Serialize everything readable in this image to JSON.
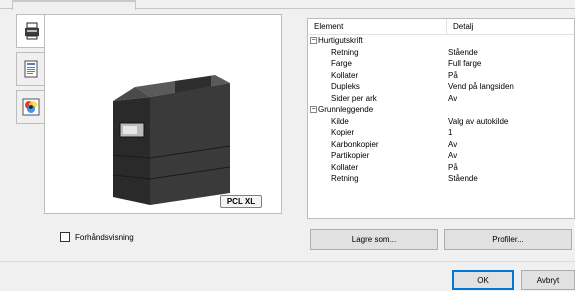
{
  "sidebar": {
    "tabs": [
      {
        "icon": "printer-settings-icon"
      },
      {
        "icon": "document-icon"
      },
      {
        "icon": "color-quality-icon"
      }
    ]
  },
  "preview": {
    "badge": "PCL XL",
    "checkbox_label": "Forhåndsvisning"
  },
  "table": {
    "col_element": "Element",
    "col_detail": "Detalj",
    "rows": [
      {
        "type": "group",
        "label": "Hurtigutskrift",
        "value": ""
      },
      {
        "type": "item",
        "label": "Retning",
        "value": "Stående"
      },
      {
        "type": "item",
        "label": "Farge",
        "value": "Full farge"
      },
      {
        "type": "item",
        "label": "Kollater",
        "value": "På"
      },
      {
        "type": "item",
        "label": "Dupleks",
        "value": "Vend på langsiden"
      },
      {
        "type": "item",
        "label": "Sider per ark",
        "value": "Av"
      },
      {
        "type": "group",
        "label": "Grunnleggende",
        "value": ""
      },
      {
        "type": "item",
        "label": "Kilde",
        "value": "Valg av autokilde"
      },
      {
        "type": "item",
        "label": "Kopier",
        "value": "1"
      },
      {
        "type": "item",
        "label": "Karbonkopier",
        "value": "Av"
      },
      {
        "type": "item",
        "label": "Partikopier",
        "value": "Av"
      },
      {
        "type": "item",
        "label": "Kollater",
        "value": "På"
      },
      {
        "type": "item",
        "label": "Retning",
        "value": "Stående"
      }
    ]
  },
  "buttons": {
    "save_as": "Lagre som...",
    "profiles": "Profiler...",
    "ok": "OK",
    "cancel": "Avbryt"
  }
}
